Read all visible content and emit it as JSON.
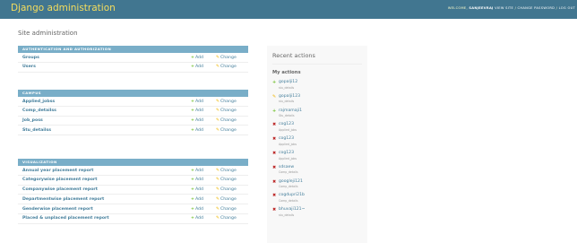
{
  "header": {
    "branding": "Django administration",
    "welcome": "WELCOME,",
    "username": "SANJEEVRAJ",
    "links": [
      "VIEW SITE",
      "CHANGE PASSWORD",
      "LOG OUT"
    ]
  },
  "page_title": "Site administration",
  "labels": {
    "add": "Add",
    "change": "Change"
  },
  "modules": [
    {
      "caption": "Authentication and Authorization",
      "models": [
        "Groups",
        "Users"
      ]
    },
    {
      "caption": "Campus",
      "models": [
        "Applied_jobss",
        "Comp_detailss",
        "Job_poss",
        "Stu_detailss"
      ]
    },
    {
      "caption": "Visualization",
      "models": [
        "Annual year placement report",
        "Categorywise placement report",
        "Companywise placement report",
        "Departmentwise placement report",
        "Genderwise placement report",
        "Placed & unplaced placement report"
      ]
    }
  ],
  "recent": {
    "title": "Recent actions",
    "my_actions": "My actions",
    "items": [
      {
        "type": "addition",
        "object": "gopalji12",
        "ctype": "stu_details"
      },
      {
        "type": "change",
        "object": "gopalji123",
        "ctype": "stu_details"
      },
      {
        "type": "addition",
        "object": "rajmamaji1",
        "ctype": "Stu_details"
      },
      {
        "type": "deletion",
        "object": "cog123",
        "ctype": "Applied_jobs"
      },
      {
        "type": "deletion",
        "object": "cog123",
        "ctype": "Applied_jobs"
      },
      {
        "type": "deletion",
        "object": "cog123",
        "ctype": "Applied_jobs"
      },
      {
        "type": "deletion",
        "object": "sdsaew",
        "ctype": "Comp_details"
      },
      {
        "type": "deletion",
        "object": "googleji121",
        "ctype": "Comp_details"
      },
      {
        "type": "deletion",
        "object": "cogdupri21b",
        "ctype": "Comp_details"
      },
      {
        "type": "deletion",
        "object": "bhuvaji121~",
        "ctype": "stu_details"
      }
    ]
  },
  "colors": {
    "header": "#417690",
    "branding": "#f5dd5d",
    "caption": "#79aec8",
    "link": "#447e9b",
    "add": "#70bf2b",
    "change": "#efb80b",
    "delete": "#ba2121"
  }
}
